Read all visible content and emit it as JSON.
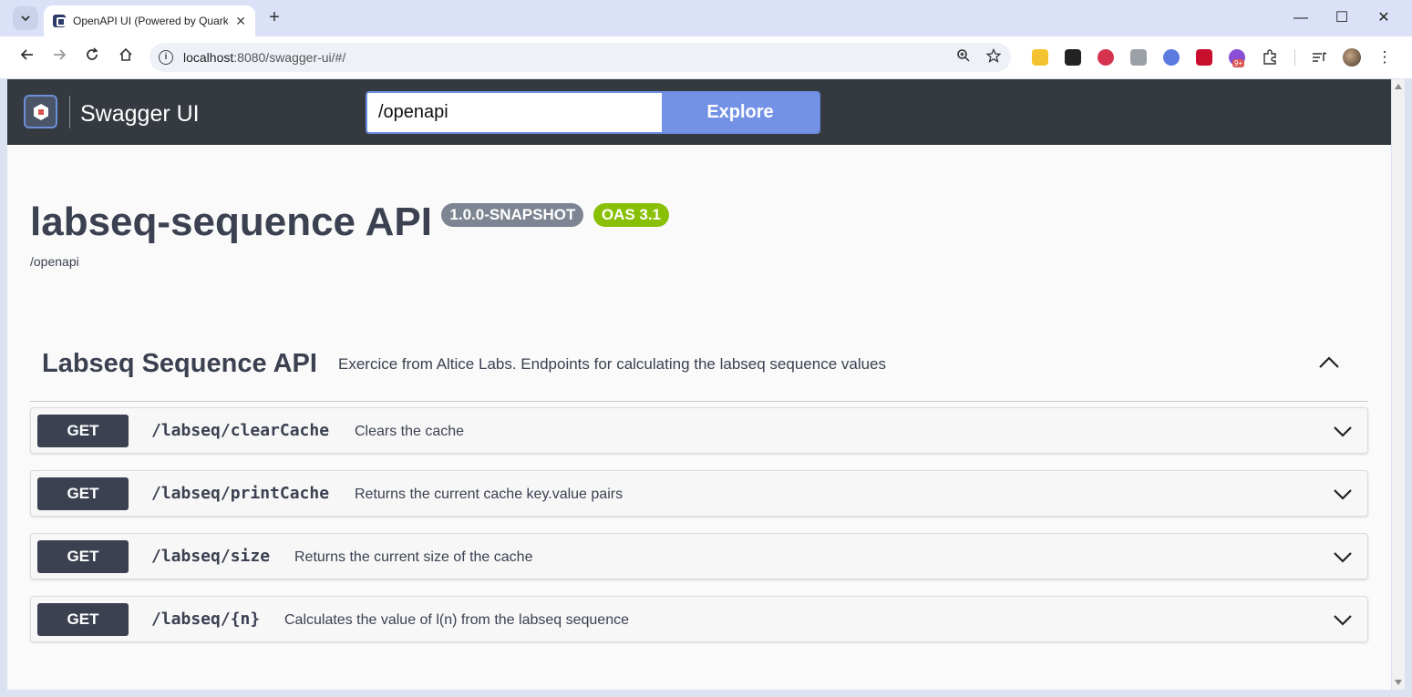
{
  "browser": {
    "tab_title": "OpenAPI UI (Powered by Quarkus)",
    "url_host": "localhost",
    "url_rest": ":8080/swagger-ui/#/",
    "ext_badge": "9+"
  },
  "header": {
    "brand": "Swagger UI",
    "search_value": "/openapi",
    "explore_label": "Explore"
  },
  "info": {
    "title": "labseq-sequence API",
    "version": "1.0.0-SNAPSHOT",
    "oas": "OAS 3.1",
    "base_url": "/openapi"
  },
  "tag": {
    "name": "Labseq Sequence API",
    "description": "Exercice from Altice Labs. Endpoints for calculating the labseq sequence values"
  },
  "operations": [
    {
      "method": "GET",
      "path": "/labseq/clearCache",
      "summary": "Clears the cache"
    },
    {
      "method": "GET",
      "path": "/labseq/printCache",
      "summary": "Returns the current cache key.value pairs"
    },
    {
      "method": "GET",
      "path": "/labseq/size",
      "summary": "Returns the current size of the cache"
    },
    {
      "method": "GET",
      "path": "/labseq/{n}",
      "summary": "Calculates the value of l(n) from the labseq sequence"
    }
  ],
  "colors": {
    "topbar": "#343a40",
    "explore": "#7392e5",
    "get_method": "#3b4151",
    "oas_badge": "#89bf04",
    "version_badge": "#7d8492"
  }
}
